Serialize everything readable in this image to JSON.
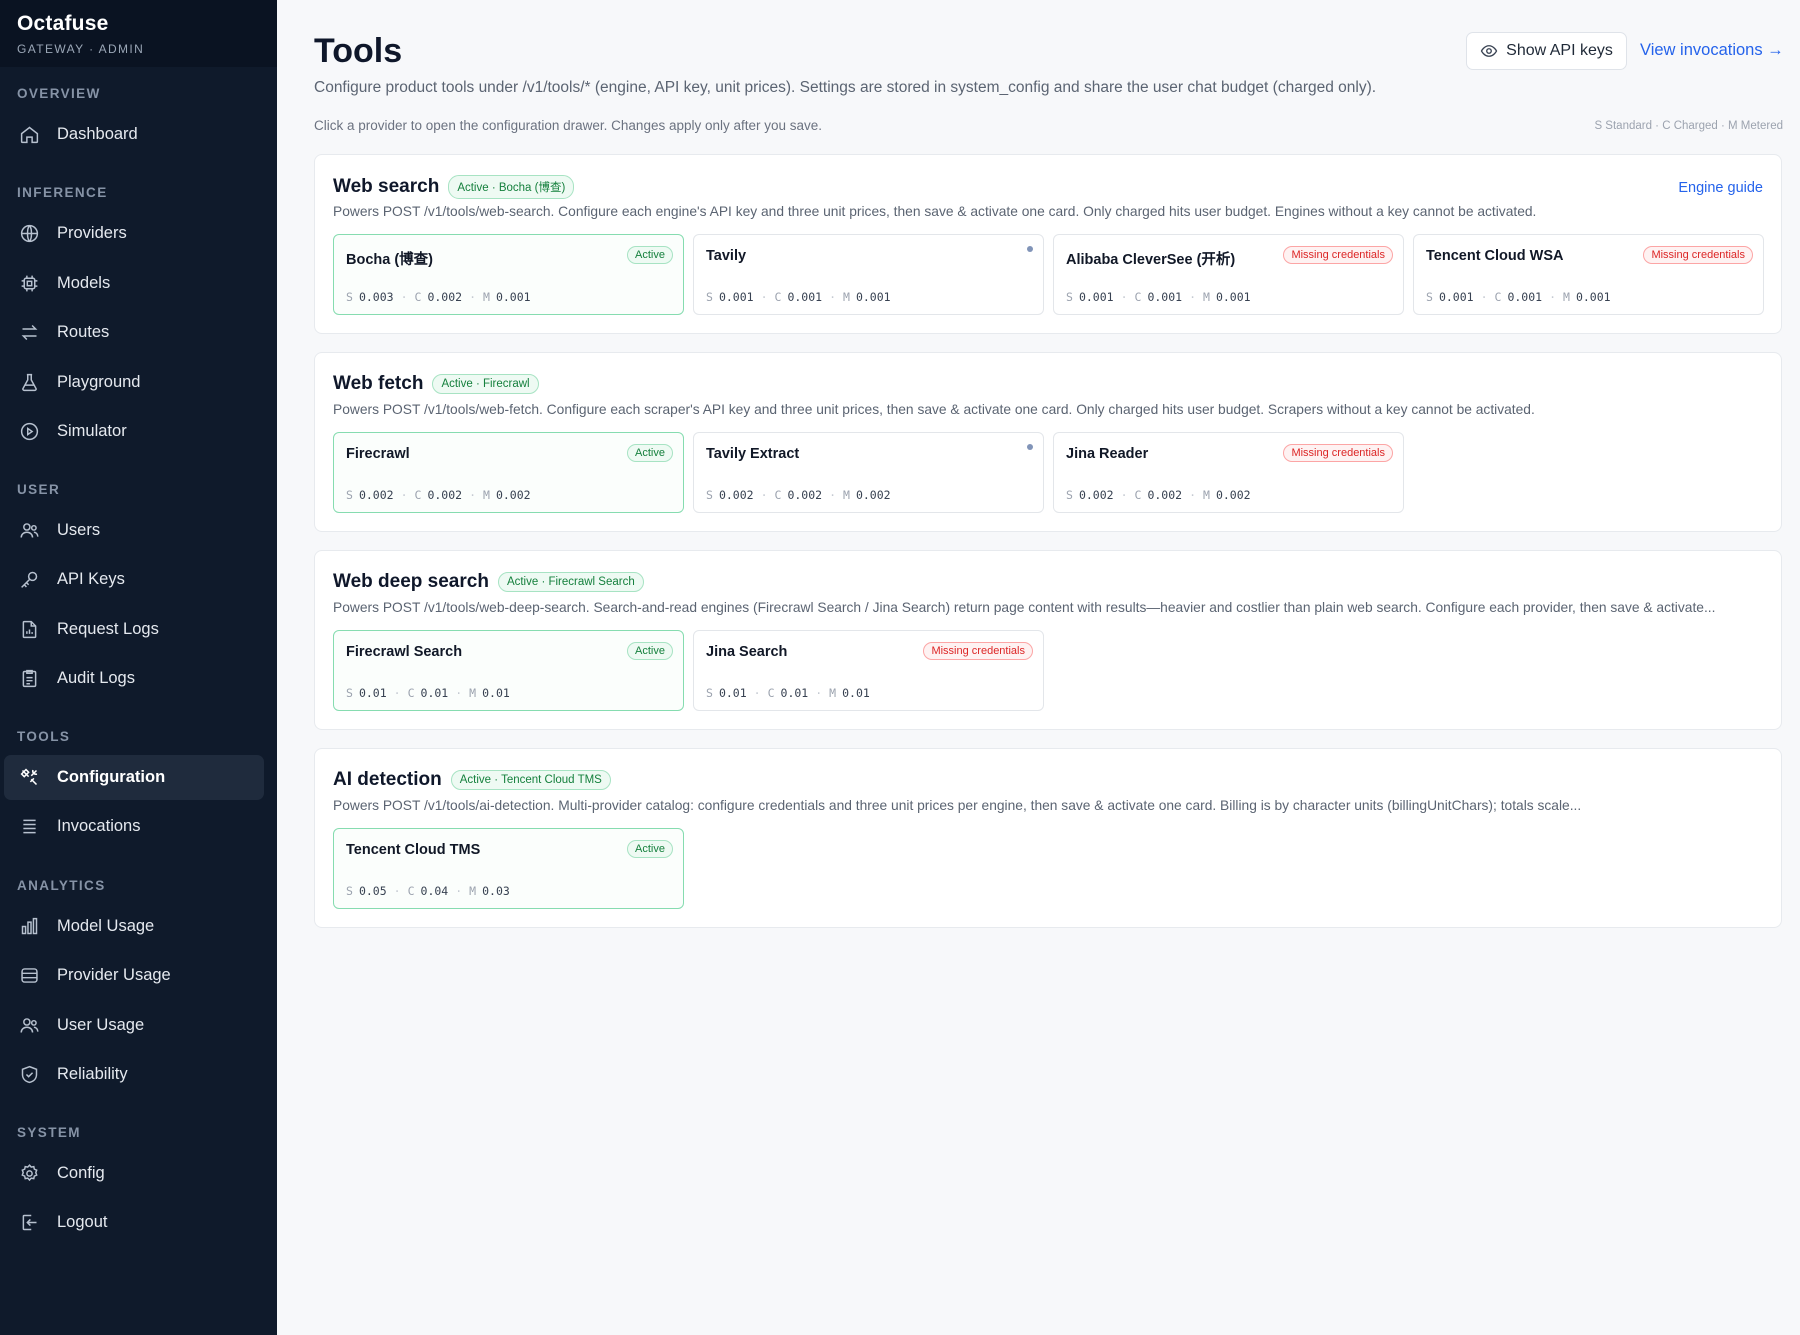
{
  "brand": {
    "name": "Octafuse",
    "sub": "GATEWAY · ADMIN"
  },
  "nav": {
    "sections": {
      "overview": "OVERVIEW",
      "inference": "INFERENCE",
      "user": "USER",
      "tools": "TOOLS",
      "analytics": "ANALYTICS",
      "system": "SYSTEM"
    },
    "items": {
      "dashboard": "Dashboard",
      "providers": "Providers",
      "models": "Models",
      "routes": "Routes",
      "playground": "Playground",
      "simulator": "Simulator",
      "users": "Users",
      "api_keys": "API Keys",
      "request_logs": "Request Logs",
      "audit_logs": "Audit Logs",
      "configuration": "Configuration",
      "invocations": "Invocations",
      "model_usage": "Model Usage",
      "provider_usage": "Provider Usage",
      "user_usage": "User Usage",
      "reliability": "Reliability",
      "config": "Config",
      "logout": "Logout"
    },
    "active_item": "Configuration"
  },
  "header": {
    "title": "Tools",
    "description": "Configure product tools under /v1/tools/* (engine, API key, unit prices). Settings are stored in system_config and share the user chat budget (charged only).",
    "hint": "Click a provider to open the configuration drawer. Changes apply only after you save.",
    "legend": "S Standard · C Charged · M Metered",
    "show_keys_label": "Show API keys",
    "view_invocations_label": "View invocations →"
  },
  "price_labels": {
    "s": "S",
    "c": "C",
    "m": "M"
  },
  "status_labels": {
    "active": "Active",
    "missing": "Missing credentials"
  },
  "sections": [
    {
      "title": "Web search",
      "badge": "Active · Bocha (博查)",
      "description": "Powers POST /v1/tools/web-search. Configure each engine's API key and three unit prices, then save & activate one card. Only charged hits user budget. Engines without a key cannot be activated.",
      "link": "Engine guide",
      "cards": [
        {
          "name": "Bocha (博查)",
          "status": "active",
          "s": "0.003",
          "c": "0.002",
          "m": "0.001"
        },
        {
          "name": "Tavily",
          "status": "dot",
          "s": "0.001",
          "c": "0.001",
          "m": "0.001"
        },
        {
          "name": "Alibaba CleverSee (开析)",
          "status": "missing",
          "s": "0.001",
          "c": "0.001",
          "m": "0.001"
        },
        {
          "name": "Tencent Cloud WSA",
          "status": "missing",
          "s": "0.001",
          "c": "0.001",
          "m": "0.001"
        }
      ]
    },
    {
      "title": "Web fetch",
      "badge": "Active · Firecrawl",
      "description": "Powers POST /v1/tools/web-fetch. Configure each scraper's API key and three unit prices, then save & activate one card. Only charged hits user budget. Scrapers without a key cannot be activated.",
      "cards": [
        {
          "name": "Firecrawl",
          "status": "active",
          "s": "0.002",
          "c": "0.002",
          "m": "0.002"
        },
        {
          "name": "Tavily Extract",
          "status": "dot",
          "s": "0.002",
          "c": "0.002",
          "m": "0.002"
        },
        {
          "name": "Jina Reader",
          "status": "missing",
          "s": "0.002",
          "c": "0.002",
          "m": "0.002"
        }
      ]
    },
    {
      "title": "Web deep search",
      "badge": "Active · Firecrawl Search",
      "description": "Powers POST /v1/tools/web-deep-search. Search-and-read engines (Firecrawl Search / Jina Search) return page content with results—heavier and costlier than plain web search. Configure each provider, then save & activate...",
      "cards": [
        {
          "name": "Firecrawl Search",
          "status": "active",
          "s": "0.01",
          "c": "0.01",
          "m": "0.01"
        },
        {
          "name": "Jina Search",
          "status": "missing",
          "s": "0.01",
          "c": "0.01",
          "m": "0.01"
        }
      ]
    },
    {
      "title": "AI detection",
      "badge": "Active · Tencent Cloud TMS",
      "description": "Powers POST /v1/tools/ai-detection. Multi-provider catalog: configure credentials and three unit prices per engine, then save & activate one card. Billing is by character units (billingUnitChars); totals scale...",
      "cards": [
        {
          "name": "Tencent Cloud TMS",
          "status": "active",
          "s": "0.05",
          "c": "0.04",
          "m": "0.03"
        }
      ]
    }
  ]
}
